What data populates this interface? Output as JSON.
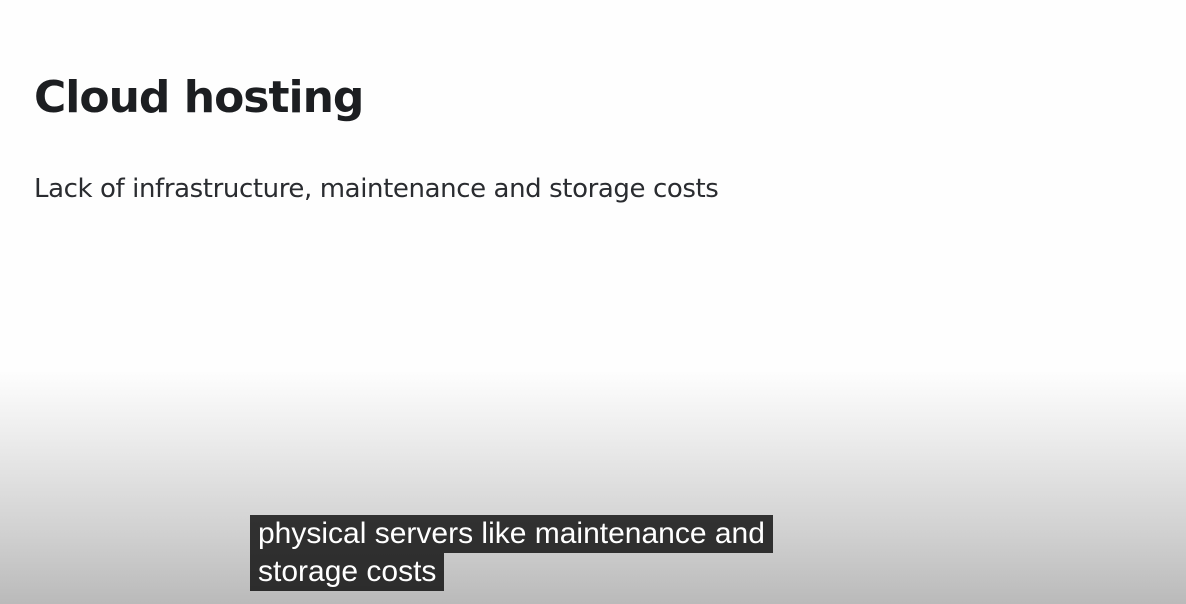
{
  "slide": {
    "title": "Cloud hosting",
    "subtitle": "Lack of infrastructure, maintenance and storage costs"
  },
  "captions": {
    "lines": [
      "physical servers like maintenance and",
      "storage costs"
    ]
  },
  "colors": {
    "slide_background": "#fefefe",
    "title_text": "#1c1e21",
    "subtitle_text": "#2a2c30",
    "caption_background": "#080808",
    "caption_text": "#ffffff"
  }
}
